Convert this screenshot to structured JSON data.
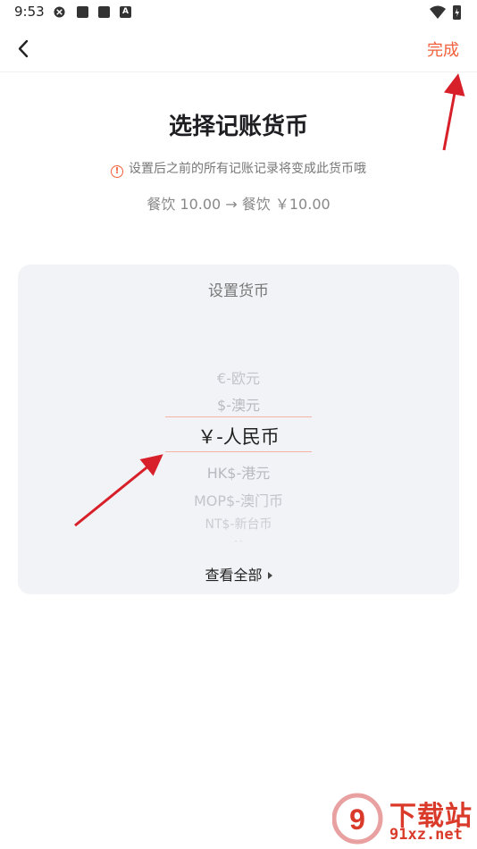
{
  "status_bar": {
    "time": "9:53"
  },
  "nav": {
    "done_label": "完成"
  },
  "header": {
    "title": "选择记账货币",
    "warning": "设置后之前的所有记账记录将变成此货币哦",
    "example": "餐饮 10.00 → 餐饮 ￥10.00"
  },
  "card": {
    "title": "设置货币",
    "view_all": "查看全部",
    "selected_index": 2,
    "currencies": [
      {
        "label": "€-欧元"
      },
      {
        "label": "$-澳元"
      },
      {
        "label": "￥-人民币"
      },
      {
        "label": "HK$-港元"
      },
      {
        "label": "MOP$-澳门币"
      },
      {
        "label": "NT$-新台币"
      },
      {
        "label": "$-美元"
      }
    ]
  },
  "watermark": {
    "text": "下载站",
    "url": "91xz.net"
  },
  "colors": {
    "accent": "#f2603c",
    "card_bg": "#f2f3f7",
    "annotation": "#d8202a"
  }
}
